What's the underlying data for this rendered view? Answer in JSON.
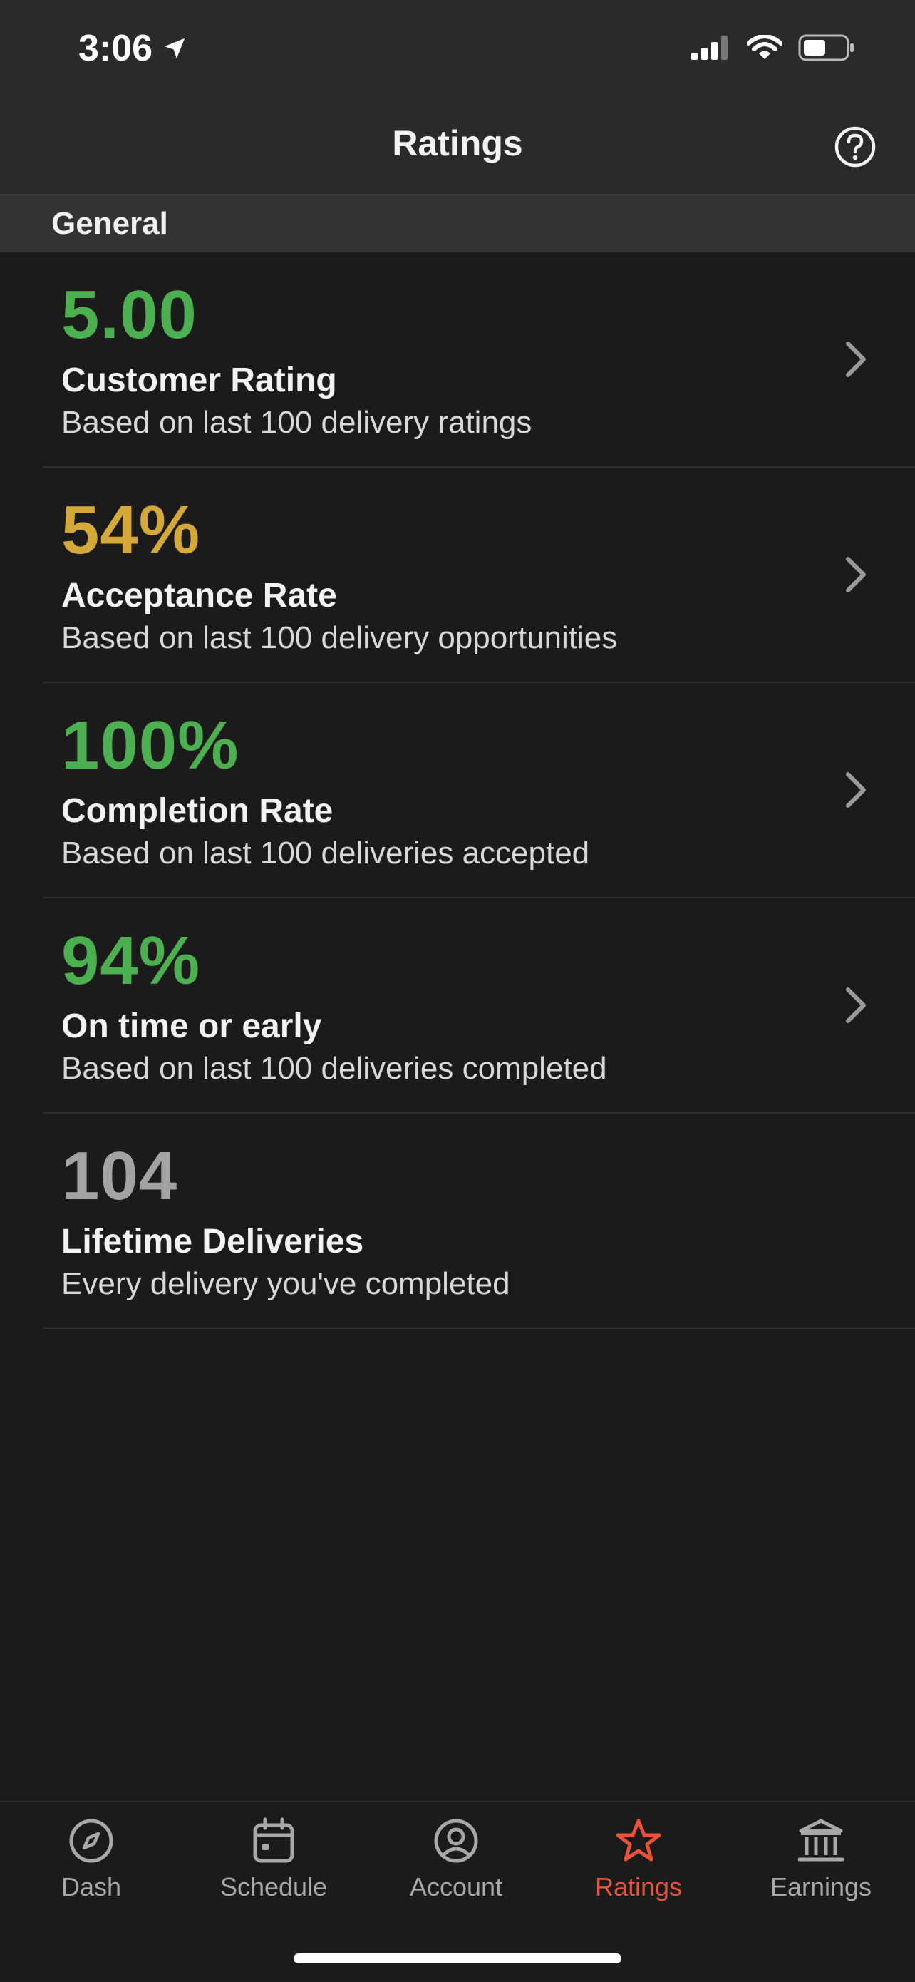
{
  "status_bar": {
    "time": "3:06"
  },
  "header": {
    "title": "Ratings"
  },
  "section": {
    "title": "General"
  },
  "metrics": [
    {
      "value": "5.00",
      "label": "Customer Rating",
      "description": "Based on last 100 delivery ratings",
      "color": "#4caf50"
    },
    {
      "value": "54%",
      "label": "Acceptance Rate",
      "description": "Based on last 100 delivery opportunities",
      "color": "#d4a93a"
    },
    {
      "value": "100%",
      "label": "Completion Rate",
      "description": "Based on last 100 deliveries accepted",
      "color": "#4caf50"
    },
    {
      "value": "94%",
      "label": "On time or early",
      "description": "Based on last 100 deliveries completed",
      "color": "#4caf50"
    },
    {
      "value": "104",
      "label": "Lifetime Deliveries",
      "description": "Every delivery you've completed",
      "color": "#a3a3a3"
    }
  ],
  "tabs": [
    {
      "label": "Dash",
      "icon": "compass-icon"
    },
    {
      "label": "Schedule",
      "icon": "calendar-icon"
    },
    {
      "label": "Account",
      "icon": "user-icon"
    },
    {
      "label": "Ratings",
      "icon": "star-icon",
      "active": true
    },
    {
      "label": "Earnings",
      "icon": "bank-icon"
    }
  ],
  "colors": {
    "accent": "#e8533a",
    "background": "#1b1b1b",
    "header": "#2a2a2a"
  }
}
